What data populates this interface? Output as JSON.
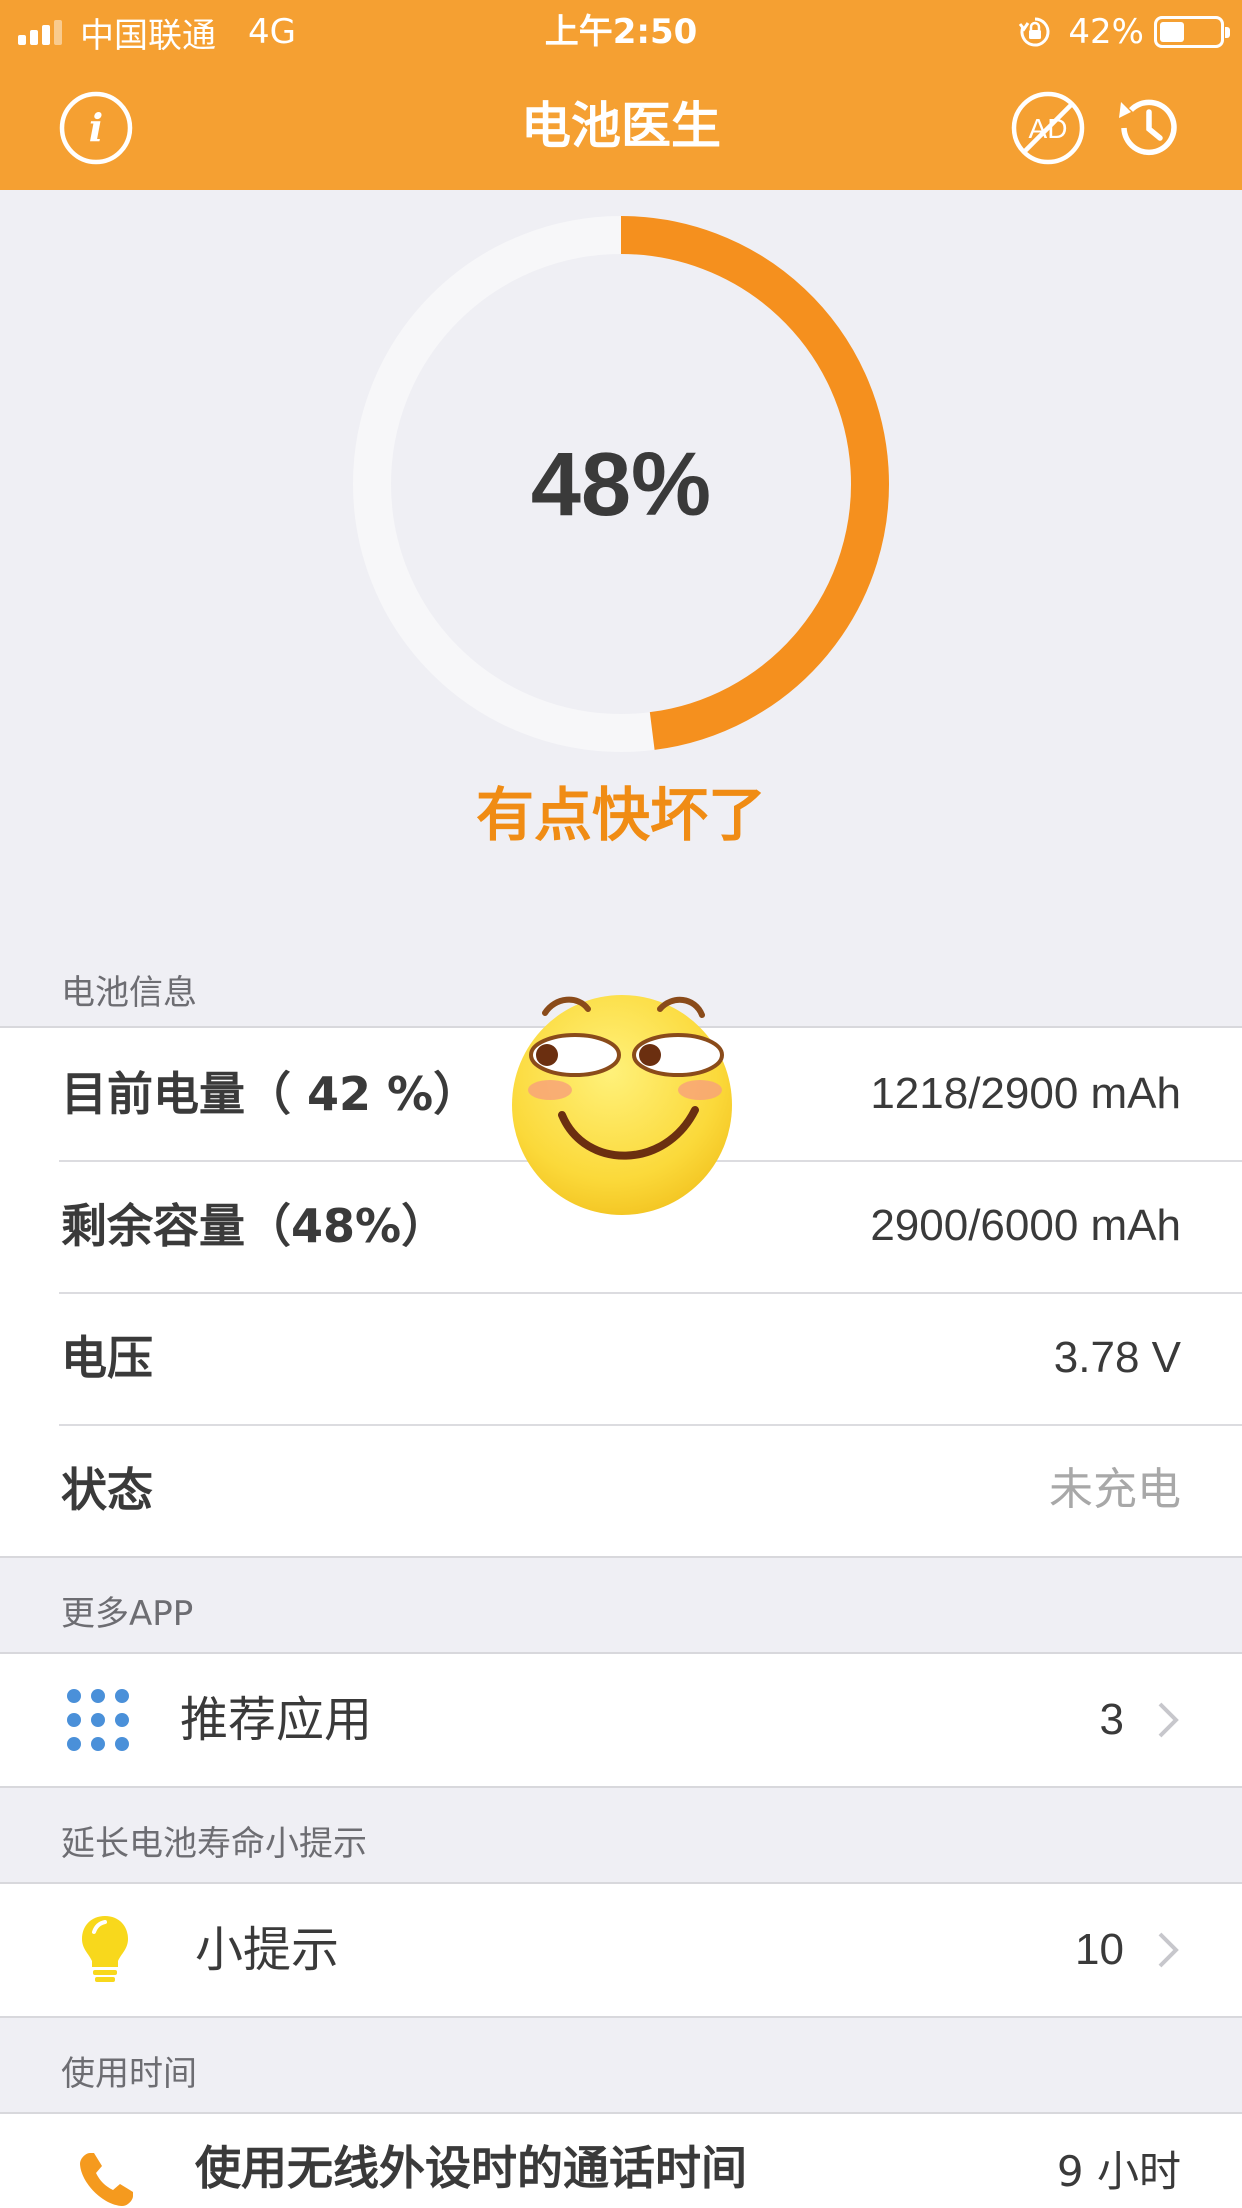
{
  "status_bar": {
    "carrier": "中国联通",
    "network": "4G",
    "time": "上午2:50",
    "battery_percent": "42%",
    "battery_level": 0.42
  },
  "nav": {
    "title": "电池医生",
    "info_icon": "info-icon",
    "no_ads_icon": "no-ads-icon",
    "no_ads_text": "AD",
    "history_icon": "history-icon"
  },
  "gauge": {
    "value_text": "48%",
    "fraction": 0.48,
    "status": "有点快坏了",
    "color": "#f5901e",
    "track_color": "#f7f7f9"
  },
  "battery_info": {
    "header": "电池信息",
    "rows": [
      {
        "label": "目前电量（ 42 %）",
        "value": "1218/2900 mAh"
      },
      {
        "label": "剩余容量（48%）",
        "value": "2900/6000 mAh"
      },
      {
        "label": "电压",
        "value": "3.78 V"
      },
      {
        "label": "状态",
        "value": "未充电"
      }
    ]
  },
  "more_apps": {
    "header": "更多APP",
    "row": {
      "icon": "grid-dots-icon",
      "label": "推荐应用",
      "value": "3"
    }
  },
  "tips": {
    "header": "延长电池寿命小提示",
    "row": {
      "icon": "lightbulb-icon",
      "label": "小提示",
      "value": "10"
    }
  },
  "usage": {
    "header": "使用时间",
    "row": {
      "icon": "phone-icon",
      "label": "使用无线外设时的通话时间",
      "value": "9 小时"
    }
  },
  "colors": {
    "brand_orange": "#f5a032",
    "accent_orange": "#f08c14",
    "background": "#efeff4",
    "icon_blue": "#4a90d9"
  },
  "overlay": {
    "icon": "smirk-emoji-icon"
  }
}
